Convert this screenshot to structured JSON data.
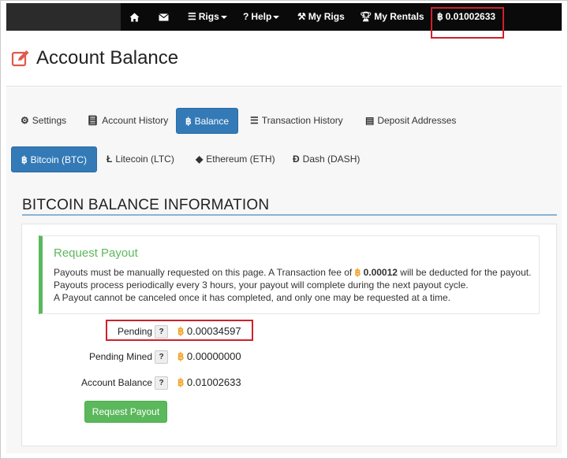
{
  "navbar": {
    "home_icon": "home-icon",
    "mail_icon": "envelope-icon",
    "rigs_label": "Rigs",
    "help_label": "Help",
    "my_rigs_label": "My Rigs",
    "my_rentals_label": "My Rentals",
    "balance_label": "0.01002633"
  },
  "header": {
    "title": "Account Balance"
  },
  "tabs": [
    {
      "label": "Settings",
      "icon": "gear-icon"
    },
    {
      "label": "Account History",
      "icon": "book-icon"
    },
    {
      "label": "Balance",
      "icon": "bitcoin-icon"
    },
    {
      "label": "Transaction History",
      "icon": "list-icon"
    },
    {
      "label": "Deposit Addresses",
      "icon": "wallet-icon"
    }
  ],
  "coin_tabs": [
    {
      "label": "Bitcoin (BTC)",
      "icon": "bitcoin-icon"
    },
    {
      "label": "Litecoin (LTC)",
      "icon": "litecoin-icon"
    },
    {
      "label": "Ethereum (ETH)",
      "icon": "ethereum-icon"
    },
    {
      "label": "Dash (DASH)",
      "icon": "dash-icon"
    }
  ],
  "section": {
    "heading": "BITCOIN BALANCE INFORMATION"
  },
  "payout_notice": {
    "title": "Request Payout",
    "line1_pre": "Payouts must be manually requested on this page. A Transaction fee of",
    "fee": "0.00012",
    "line1_post": "will be deducted for the payout.",
    "line2": "Payouts process periodically every 3 hours, your payout will complete during the next payout cycle.",
    "line3": "A Payout cannot be canceled once it has completed, and only one may be requested at a time."
  },
  "balances": [
    {
      "label": "Pending",
      "value": "0.00034597"
    },
    {
      "label": "Pending Mined",
      "value": "0.00000000"
    },
    {
      "label": "Account Balance",
      "value": "0.01002633"
    }
  ],
  "help_badge": "?",
  "btc_symbol": "฿",
  "request_button": "Request Payout",
  "colors": {
    "accent": "#337ab7",
    "success": "#5cb85c",
    "highlight": "#d0202a",
    "bitcoin": "#f0a01c"
  }
}
